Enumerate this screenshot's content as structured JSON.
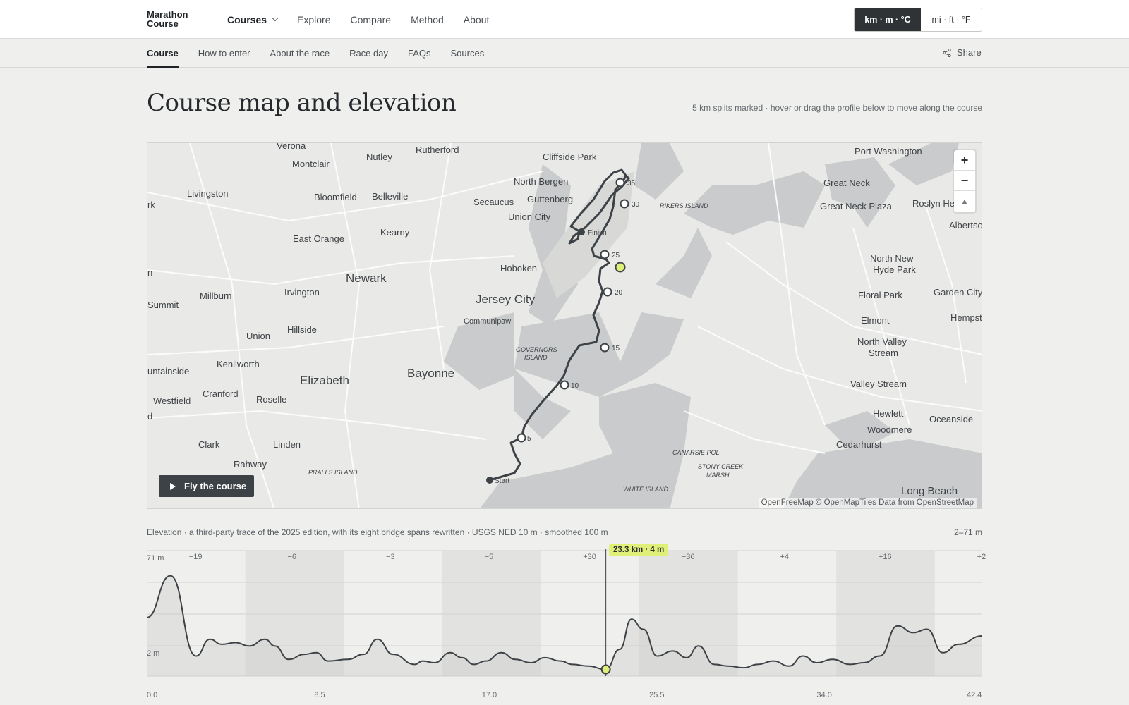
{
  "brand": {
    "line1": "Marathon",
    "line2": "Course"
  },
  "nav": {
    "courses": "Courses",
    "explore": "Explore",
    "compare": "Compare",
    "method": "Method",
    "about": "About"
  },
  "units": {
    "metric": "km · m · °C",
    "imperial": "mi · ft · °F",
    "selected": "metric"
  },
  "subnav": {
    "course": "Course",
    "how_to_enter": "How to enter",
    "about_race": "About the race",
    "race_day": "Race day",
    "faqs": "FAQs",
    "sources": "Sources",
    "share": "Share"
  },
  "page": {
    "title": "Course map and elevation",
    "hint": "5 km splits marked · hover or drag the profile below to move along the course"
  },
  "map": {
    "fly_label": "Fly the course",
    "attribution": "OpenFreeMap © OpenMapTiles Data from OpenStreetMap",
    "zoom_in": "+",
    "zoom_out": "−",
    "reset": "▲",
    "places": {
      "verona": "Verona",
      "nutley": "Nutley",
      "rutherford": "Rutherford",
      "cliffside_park": "Cliffside Park",
      "port_washington": "Port Washington",
      "montclair": "Montclair",
      "north_bergen": "North Bergen",
      "livingston": "Livingston",
      "great_neck": "Great Neck",
      "bloomfield": "Bloomfield",
      "belleville": "Belleville",
      "secaucus": "Secaucus",
      "guttenberg": "Guttenberg",
      "great_neck_plaza": "Great Neck Plaza",
      "roslyn": "Roslyn He",
      "rikers": "RIKERS ISLAND",
      "union_city": "Union City",
      "albertson": "Albertson",
      "kearny": "Kearny",
      "east_orange": "East Orange",
      "north_new_hyde_park": "North New",
      "hyde_park": "Hyde Park",
      "hoboken": "Hoboken",
      "newark": "Newark",
      "jersey_city": "Jersey City",
      "millburn": "Millburn",
      "irvington": "Irvington",
      "floral_park": "Floral Park",
      "garden_city": "Garden City",
      "summit": "Summit",
      "communipaw": "Communipaw",
      "elmont": "Elmont",
      "hempstead": "Hempste",
      "hillside": "Hillside",
      "union": "Union",
      "north_valley": "North Valley",
      "stream": "Stream",
      "governors": "GOVERNORS",
      "island": "ISLAND",
      "kenilworth": "Kenilworth",
      "mountainside": "untainside",
      "elizabeth": "Elizabeth",
      "bayonne": "Bayonne",
      "valley_stream": "Valley Stream",
      "westfield": "Westfield",
      "cranford": "Cranford",
      "roselle": "Roselle",
      "hewlett": "Hewlett",
      "oceanside": "Oceanside",
      "woodmere": "Woodmere",
      "clark": "Clark",
      "linden": "Linden",
      "cedarhurst": "Cedarhurst",
      "canarsie": "CANARSIE POL",
      "stony_creek": "STONY CREEK",
      "marsh": "MARSH",
      "rahway": "Rahway",
      "pralls": "PRALLS ISLAND",
      "white_island": "WHITE ISLAND",
      "long_beach": "Long Beach",
      "rk": "rk",
      "n": "n",
      "d": "d"
    },
    "markers": {
      "finish": "Finish",
      "start": "Start",
      "k5": "5",
      "k10": "10",
      "k15": "15",
      "k20": "20",
      "k25": "25",
      "k30": "30",
      "k35": "35"
    }
  },
  "elevation": {
    "caption": "Elevation · a third-party trace of the 2025 edition, with its eight bridge spans rewritten · USGS NED 10 m · smoothed 100 m",
    "range": "2–71 m",
    "y_top": "71 m",
    "y_bottom": "2 m",
    "cursor": "23.3 km · 4 m",
    "x_ticks": [
      "0.0",
      "8.5",
      "17.0",
      "25.5",
      "34.0",
      "42.4"
    ],
    "deltas": [
      "−19",
      "−6",
      "−3",
      "−5",
      "+30",
      "−36",
      "+4",
      "+16",
      "+2"
    ],
    "chart_data": {
      "type": "area",
      "xlabel": "",
      "ylabel": "",
      "xlim": [
        0,
        42.4
      ],
      "ylim": [
        2,
        71
      ],
      "x": [
        0,
        1.2,
        2.5,
        3.2,
        3.8,
        4.5,
        5.2,
        6.0,
        6.5,
        7.2,
        8.0,
        8.6,
        9.2,
        10.2,
        11.0,
        11.7,
        12.5,
        13.6,
        14.0,
        14.6,
        15.4,
        16.0,
        16.6,
        17.2,
        18.0,
        18.7,
        19.5,
        20.2,
        21.0,
        21.6,
        22.4,
        23.3,
        24.0,
        24.6,
        25.2,
        25.9,
        26.7,
        27.4,
        28.0,
        28.8,
        29.5,
        30.3,
        31.0,
        31.8,
        32.6,
        33.3,
        34.0,
        34.8,
        35.7,
        36.4,
        37.2,
        38.1,
        38.9,
        39.6,
        40.4,
        41.2,
        42.4
      ],
      "y": [
        35,
        60,
        12,
        22,
        19,
        20,
        18,
        22,
        18,
        10,
        13,
        14,
        9,
        10,
        13,
        22,
        13,
        7,
        9,
        8,
        14,
        11,
        7,
        9,
        14,
        10,
        8,
        11,
        9,
        7,
        6,
        4,
        16,
        34,
        28,
        12,
        15,
        11,
        18,
        7,
        6,
        5,
        7,
        9,
        6,
        12,
        8,
        10,
        7,
        8,
        12,
        30,
        26,
        28,
        14,
        19,
        24
      ]
    }
  }
}
